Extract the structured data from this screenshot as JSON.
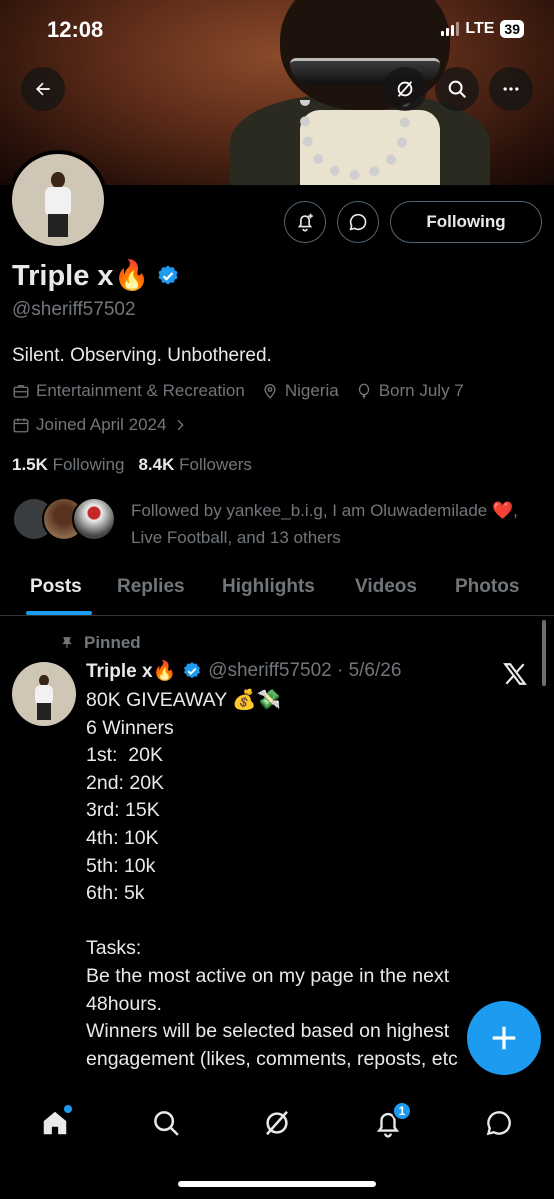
{
  "status": {
    "time": "12:08",
    "network": "LTE",
    "battery": "39"
  },
  "profile": {
    "name": "Triple x🔥",
    "handle": "@sheriff57502",
    "bio": "Silent. Observing. Unbothered.",
    "category": "Entertainment & Recreation",
    "location": "Nigeria",
    "birthday": "Born July 7",
    "joined": "Joined April 2024",
    "following_count": "1.5K",
    "following_label": "Following",
    "followers_count": "8.4K",
    "followers_label": "Followers",
    "follow_button": "Following",
    "followed_by": "Followed by yankee_b.i.g, I am Oluwademilade ❤️, Live Football, and 13 others"
  },
  "tabs": [
    "Posts",
    "Replies",
    "Highlights",
    "Videos",
    "Photos"
  ],
  "post": {
    "pinned_label": "Pinned",
    "author": "Triple x🔥",
    "handle_date": "@sheriff57502 · 5/6/26",
    "body": "80K GIVEAWAY 💰💸\n6 Winners\n1st:  20K\n2nd: 20K\n3rd: 15K\n4th: 10K\n5th: 10k\n6th: 5k\n\nTasks:\nBe the most active on my page in the next 48hours.\nWinners will be selected based on highest engagement (likes, comments, reposts, etc"
  },
  "nav": {
    "notifications_badge": "1"
  },
  "colors": {
    "accent": "#1d9bf0",
    "background": "#000000",
    "muted": "#71767b"
  },
  "icons": [
    "back-arrow-icon",
    "grok-icon",
    "search-icon",
    "more-icon",
    "notify-bell-plus-icon",
    "message-icon",
    "verified-badge-icon",
    "briefcase-icon",
    "location-pin-icon",
    "balloon-icon",
    "calendar-icon",
    "chevron-right-icon",
    "pin-icon",
    "x-logo-icon",
    "plus-icon",
    "home-icon",
    "bell-icon",
    "chat-icon"
  ]
}
